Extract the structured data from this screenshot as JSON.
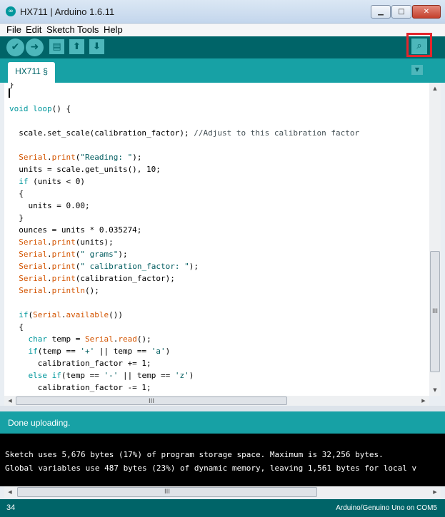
{
  "window": {
    "title": "HX711 | Arduino 1.6.11",
    "logo_glyph": "∞",
    "minimize_glyph": "▁",
    "maximize_glyph": "□",
    "close_glyph": "✕"
  },
  "menu": {
    "items": [
      "File",
      "Edit",
      "Sketch",
      "Tools",
      "Help"
    ]
  },
  "toolbar": {
    "buttons": [
      {
        "name": "verify",
        "icon": "check-icon",
        "glyph": "✔"
      },
      {
        "name": "upload",
        "icon": "arrow-right-icon",
        "glyph": "➜"
      },
      {
        "name": "new",
        "icon": "new-file-icon",
        "glyph": "▤"
      },
      {
        "name": "open",
        "icon": "arrow-up-icon",
        "glyph": "⬆"
      },
      {
        "name": "save",
        "icon": "arrow-down-icon",
        "glyph": "⬇"
      }
    ],
    "serial_monitor": {
      "icon": "magnifier-icon",
      "glyph": "⌕",
      "highlight_color": "#e3262c"
    }
  },
  "tabs": {
    "active": "HX711 §",
    "menu_glyph": "▼"
  },
  "editor": {
    "lines": [
      "}",
      "",
      "void loop() {",
      "",
      "  scale.set_scale(calibration_factor); //Adjust to this calibration factor",
      "",
      "  Serial.print(\"Reading: \");",
      "  units = scale.get_units(), 10;",
      "  if (units < 0)",
      "  {",
      "    units = 0.00;",
      "  }",
      "  ounces = units * 0.035274;",
      "  Serial.print(units);",
      "  Serial.print(\" grams\");",
      "  Serial.print(\" calibration_factor: \");",
      "  Serial.print(calibration_factor);",
      "  Serial.println();",
      "",
      "  if(Serial.available())",
      "  {",
      "    char temp = Serial.read();",
      "    if(temp == '+' || temp == 'a')",
      "      calibration_factor += 1;",
      "    else if(temp == '-' || temp == 'z')",
      "      calibration_factor -= 1;"
    ],
    "colors": {
      "keyword": "#00979c",
      "serial": "#d35400",
      "string": "#005c5f",
      "comment": "#434f54"
    }
  },
  "scrollbars": {
    "up": "▲",
    "down": "▼",
    "left": "◀",
    "right": "▶",
    "grip": "III"
  },
  "status": {
    "message": "Done uploading."
  },
  "console": {
    "lines": [
      "Sketch uses 5,676 bytes (17%) of program storage space. Maximum is 32,256 bytes.",
      "Global variables use 487 bytes (23%) of dynamic memory, leaving 1,561 bytes for local v"
    ]
  },
  "footer": {
    "line_number": "34",
    "board": "Arduino/Genuino Uno on COM5"
  },
  "colors": {
    "teal_dark": "#006468",
    "teal": "#17a1a5",
    "teal_light": "#4db7bb"
  }
}
